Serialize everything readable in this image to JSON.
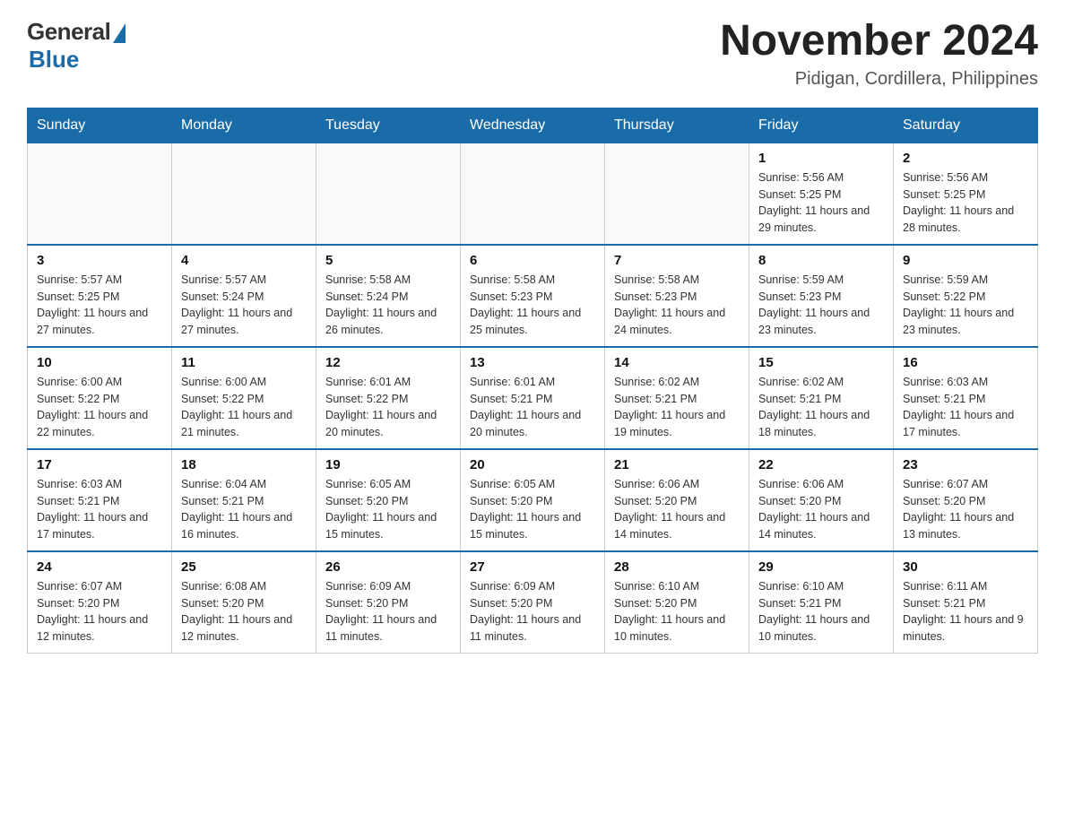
{
  "header": {
    "logo_general": "General",
    "logo_blue": "Blue",
    "title": "November 2024",
    "location": "Pidigan, Cordillera, Philippines"
  },
  "days_of_week": [
    "Sunday",
    "Monday",
    "Tuesday",
    "Wednesday",
    "Thursday",
    "Friday",
    "Saturday"
  ],
  "weeks": [
    [
      {
        "day": "",
        "info": ""
      },
      {
        "day": "",
        "info": ""
      },
      {
        "day": "",
        "info": ""
      },
      {
        "day": "",
        "info": ""
      },
      {
        "day": "",
        "info": ""
      },
      {
        "day": "1",
        "info": "Sunrise: 5:56 AM\nSunset: 5:25 PM\nDaylight: 11 hours and 29 minutes."
      },
      {
        "day": "2",
        "info": "Sunrise: 5:56 AM\nSunset: 5:25 PM\nDaylight: 11 hours and 28 minutes."
      }
    ],
    [
      {
        "day": "3",
        "info": "Sunrise: 5:57 AM\nSunset: 5:25 PM\nDaylight: 11 hours and 27 minutes."
      },
      {
        "day": "4",
        "info": "Sunrise: 5:57 AM\nSunset: 5:24 PM\nDaylight: 11 hours and 27 minutes."
      },
      {
        "day": "5",
        "info": "Sunrise: 5:58 AM\nSunset: 5:24 PM\nDaylight: 11 hours and 26 minutes."
      },
      {
        "day": "6",
        "info": "Sunrise: 5:58 AM\nSunset: 5:23 PM\nDaylight: 11 hours and 25 minutes."
      },
      {
        "day": "7",
        "info": "Sunrise: 5:58 AM\nSunset: 5:23 PM\nDaylight: 11 hours and 24 minutes."
      },
      {
        "day": "8",
        "info": "Sunrise: 5:59 AM\nSunset: 5:23 PM\nDaylight: 11 hours and 23 minutes."
      },
      {
        "day": "9",
        "info": "Sunrise: 5:59 AM\nSunset: 5:22 PM\nDaylight: 11 hours and 23 minutes."
      }
    ],
    [
      {
        "day": "10",
        "info": "Sunrise: 6:00 AM\nSunset: 5:22 PM\nDaylight: 11 hours and 22 minutes."
      },
      {
        "day": "11",
        "info": "Sunrise: 6:00 AM\nSunset: 5:22 PM\nDaylight: 11 hours and 21 minutes."
      },
      {
        "day": "12",
        "info": "Sunrise: 6:01 AM\nSunset: 5:22 PM\nDaylight: 11 hours and 20 minutes."
      },
      {
        "day": "13",
        "info": "Sunrise: 6:01 AM\nSunset: 5:21 PM\nDaylight: 11 hours and 20 minutes."
      },
      {
        "day": "14",
        "info": "Sunrise: 6:02 AM\nSunset: 5:21 PM\nDaylight: 11 hours and 19 minutes."
      },
      {
        "day": "15",
        "info": "Sunrise: 6:02 AM\nSunset: 5:21 PM\nDaylight: 11 hours and 18 minutes."
      },
      {
        "day": "16",
        "info": "Sunrise: 6:03 AM\nSunset: 5:21 PM\nDaylight: 11 hours and 17 minutes."
      }
    ],
    [
      {
        "day": "17",
        "info": "Sunrise: 6:03 AM\nSunset: 5:21 PM\nDaylight: 11 hours and 17 minutes."
      },
      {
        "day": "18",
        "info": "Sunrise: 6:04 AM\nSunset: 5:21 PM\nDaylight: 11 hours and 16 minutes."
      },
      {
        "day": "19",
        "info": "Sunrise: 6:05 AM\nSunset: 5:20 PM\nDaylight: 11 hours and 15 minutes."
      },
      {
        "day": "20",
        "info": "Sunrise: 6:05 AM\nSunset: 5:20 PM\nDaylight: 11 hours and 15 minutes."
      },
      {
        "day": "21",
        "info": "Sunrise: 6:06 AM\nSunset: 5:20 PM\nDaylight: 11 hours and 14 minutes."
      },
      {
        "day": "22",
        "info": "Sunrise: 6:06 AM\nSunset: 5:20 PM\nDaylight: 11 hours and 14 minutes."
      },
      {
        "day": "23",
        "info": "Sunrise: 6:07 AM\nSunset: 5:20 PM\nDaylight: 11 hours and 13 minutes."
      }
    ],
    [
      {
        "day": "24",
        "info": "Sunrise: 6:07 AM\nSunset: 5:20 PM\nDaylight: 11 hours and 12 minutes."
      },
      {
        "day": "25",
        "info": "Sunrise: 6:08 AM\nSunset: 5:20 PM\nDaylight: 11 hours and 12 minutes."
      },
      {
        "day": "26",
        "info": "Sunrise: 6:09 AM\nSunset: 5:20 PM\nDaylight: 11 hours and 11 minutes."
      },
      {
        "day": "27",
        "info": "Sunrise: 6:09 AM\nSunset: 5:20 PM\nDaylight: 11 hours and 11 minutes."
      },
      {
        "day": "28",
        "info": "Sunrise: 6:10 AM\nSunset: 5:20 PM\nDaylight: 11 hours and 10 minutes."
      },
      {
        "day": "29",
        "info": "Sunrise: 6:10 AM\nSunset: 5:21 PM\nDaylight: 11 hours and 10 minutes."
      },
      {
        "day": "30",
        "info": "Sunrise: 6:11 AM\nSunset: 5:21 PM\nDaylight: 11 hours and 9 minutes."
      }
    ]
  ]
}
